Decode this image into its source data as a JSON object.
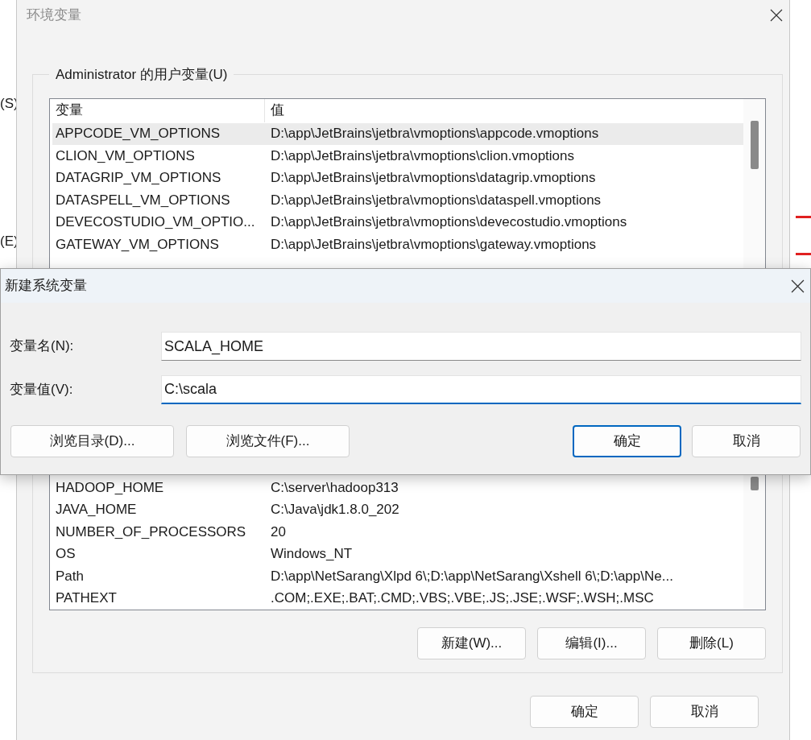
{
  "background_window": {
    "left_fragments": [
      "(S)",
      "(E)"
    ]
  },
  "env_window": {
    "title": "环境变量",
    "group_title": "Administrator 的用户变量(U)",
    "columns": [
      "变量",
      "值"
    ],
    "rows_top": [
      {
        "name": "APPCODE_VM_OPTIONS",
        "value": "D:\\app\\JetBrains\\jetbra\\vmoptions\\appcode.vmoptions",
        "selected": true
      },
      {
        "name": "CLION_VM_OPTIONS",
        "value": "D:\\app\\JetBrains\\jetbra\\vmoptions\\clion.vmoptions",
        "selected": false
      },
      {
        "name": "DATAGRIP_VM_OPTIONS",
        "value": "D:\\app\\JetBrains\\jetbra\\vmoptions\\datagrip.vmoptions",
        "selected": false
      },
      {
        "name": "DATASPELL_VM_OPTIONS",
        "value": "D:\\app\\JetBrains\\jetbra\\vmoptions\\dataspell.vmoptions",
        "selected": false
      },
      {
        "name": "DEVECOSTUDIO_VM_OPTIO...",
        "value": "D:\\app\\JetBrains\\jetbra\\vmoptions\\devecostudio.vmoptions",
        "selected": false
      },
      {
        "name": "GATEWAY_VM_OPTIONS",
        "value": "D:\\app\\JetBrains\\jetbra\\vmoptions\\gateway.vmoptions",
        "selected": false
      }
    ],
    "rows_bottom": [
      {
        "name": "HADOOP_HOME",
        "value": "C:\\server\\hadoop313",
        "selected": false
      },
      {
        "name": "JAVA_HOME",
        "value": "C:\\Java\\jdk1.8.0_202",
        "selected": false
      },
      {
        "name": "NUMBER_OF_PROCESSORS",
        "value": "20",
        "selected": false
      },
      {
        "name": "OS",
        "value": "Windows_NT",
        "selected": false
      },
      {
        "name": "Path",
        "value": "D:\\app\\NetSarang\\Xlpd 6\\;D:\\app\\NetSarang\\Xshell 6\\;D:\\app\\Ne...",
        "selected": false
      },
      {
        "name": "PATHEXT",
        "value": ".COM;.EXE;.BAT;.CMD;.VBS;.VBE;.JS;.JSE;.WSF;.WSH;.MSC",
        "selected": false
      }
    ],
    "buttons": [
      "新建(W)...",
      "编辑(I)...",
      "删除(L)"
    ],
    "footer_buttons": [
      "确定",
      "取消"
    ]
  },
  "new_var_dialog": {
    "title": "新建系统变量",
    "fields": [
      {
        "label": "变量名(N):",
        "value": "SCALA_HOME",
        "focused": false
      },
      {
        "label": "变量值(V):",
        "value": "C:\\scala",
        "focused": true
      }
    ],
    "buttons_left": [
      {
        "label": "浏览目录(D)...",
        "default": false
      },
      {
        "label": "浏览文件(F)...",
        "default": false
      }
    ],
    "buttons_right": [
      {
        "label": "确定",
        "default": true
      },
      {
        "label": "取消",
        "default": false
      }
    ]
  }
}
